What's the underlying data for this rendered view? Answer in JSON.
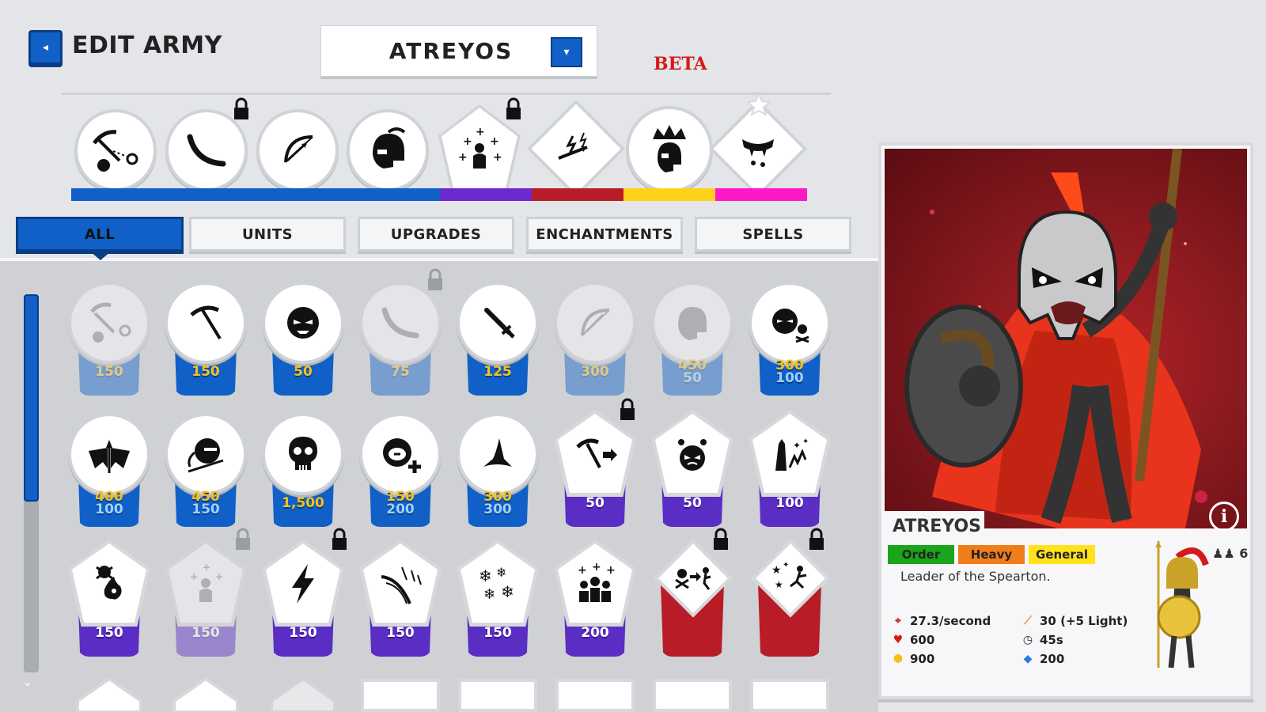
{
  "header": {
    "back_icon": "◂",
    "title": "EDIT ARMY",
    "army_name": "ATREYOS",
    "dropdown_icon": "▾",
    "beta_label": "BETA"
  },
  "colors": {
    "blue": "#1060c8",
    "purple": "#6a2ad0",
    "red": "#b81c26",
    "yellow": "#ffd21a",
    "magenta": "#ff18c8"
  },
  "top_picks": [
    "miner-icon",
    "sickle-icon",
    "bow-icon",
    "helmet-icon",
    "spearton-summon-icon",
    "lightning-arrow-icon",
    "crowned-helmet-icon",
    "fang-icon"
  ],
  "tabs": [
    "ALL",
    "UNITS",
    "UPGRADES",
    "ENCHANTMENTS",
    "SPELLS"
  ],
  "active_tab": "ALL",
  "grid": [
    {
      "icon": "miner-cart-icon",
      "cost": "150",
      "dim": true
    },
    {
      "icon": "pickaxe-icon",
      "cost": "150"
    },
    {
      "icon": "angry-face-icon",
      "cost": "50"
    },
    {
      "icon": "sickle-icon",
      "cost": "75",
      "dim": true,
      "locked": true
    },
    {
      "icon": "sword-icon",
      "cost": "125"
    },
    {
      "icon": "bow-icon",
      "cost": "300",
      "dim": true
    },
    {
      "icon": "helmet-icon",
      "cost": "450",
      "cost2": "50",
      "dim": true
    },
    {
      "icon": "skull-crossbones-face-icon",
      "cost": "300",
      "cost2": "100"
    },
    {
      "icon": "bat-wings-icon",
      "cost": "400",
      "cost2": "100"
    },
    {
      "icon": "ninja-icon",
      "cost": "450",
      "cost2": "150"
    },
    {
      "icon": "skull-icon",
      "cost": "1,500"
    },
    {
      "icon": "hooded-plus-icon",
      "cost": "150",
      "cost2": "200"
    },
    {
      "icon": "wizard-hat-icon",
      "cost": "300",
      "cost2": "300"
    },
    {
      "icon": "pickaxe-dash-icon",
      "cost": "50",
      "locked": true
    },
    {
      "icon": "rage-face-icon",
      "cost": "50"
    },
    {
      "icon": "tower-sparks-icon",
      "cost": "100"
    },
    {
      "icon": "poison-skull-icon",
      "cost": "150"
    },
    {
      "icon": "spearton-summon-icon",
      "cost": "150",
      "dim": true,
      "locked": true
    },
    {
      "icon": "lightning-icon",
      "cost": "150",
      "locked": true
    },
    {
      "icon": "arrow-rain-icon",
      "cost": "150"
    },
    {
      "icon": "snowflakes-icon",
      "cost": "150"
    },
    {
      "icon": "army-plus-icon",
      "cost": "200"
    },
    {
      "icon": "skull-dash-icon",
      "cost": "",
      "locked": true
    },
    {
      "icon": "star-runner-icon",
      "cost": "",
      "locked": true
    }
  ],
  "detail": {
    "name": "ATREYOS",
    "tags": [
      {
        "label": "Order",
        "color": "#1aa51a"
      },
      {
        "label": "Heavy",
        "color": "#f07c1a"
      },
      {
        "label": "General",
        "color": "#ffe21a"
      }
    ],
    "unit_count": "6",
    "description": "Leader of the Spearton.",
    "stats": {
      "attack_speed": "27.3/second",
      "health": "600",
      "gold": "900",
      "damage": "30 (+5 Light)",
      "time": "45s",
      "mana": "200"
    },
    "info_icon": "i"
  }
}
